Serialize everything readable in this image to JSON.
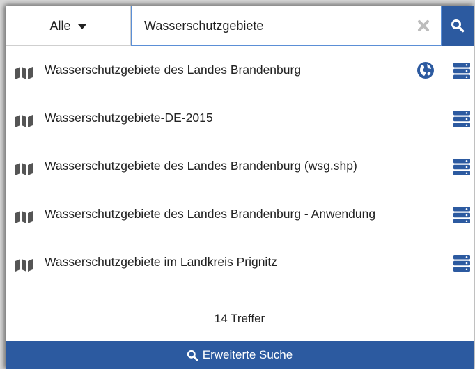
{
  "search": {
    "scope_label": "Alle",
    "query_value": "Wasserschutzgebiete",
    "accent_color": "#2c5aa0"
  },
  "results": [
    {
      "title": "Wasserschutzgebiete des Landes Brandenburg",
      "has_globe": true
    },
    {
      "title": "Wasserschutzgebiete-DE-2015",
      "has_globe": false
    },
    {
      "title": "Wasserschutzgebiete des Landes Brandenburg (wsg.shp)",
      "has_globe": false
    },
    {
      "title": "Wasserschutzgebiete des Landes Brandenburg - Anwendung",
      "has_globe": false
    },
    {
      "title": "Wasserschutzgebiete im Landkreis Prignitz",
      "has_globe": false
    }
  ],
  "icons": {
    "result_type": "map-icon",
    "web_link": "globe-icon",
    "service": "server-icon",
    "search": "search-icon",
    "clear": "clear-icon"
  },
  "footer": {
    "count_text": "14 Treffer",
    "advanced_label": "Erweiterte Suche"
  }
}
